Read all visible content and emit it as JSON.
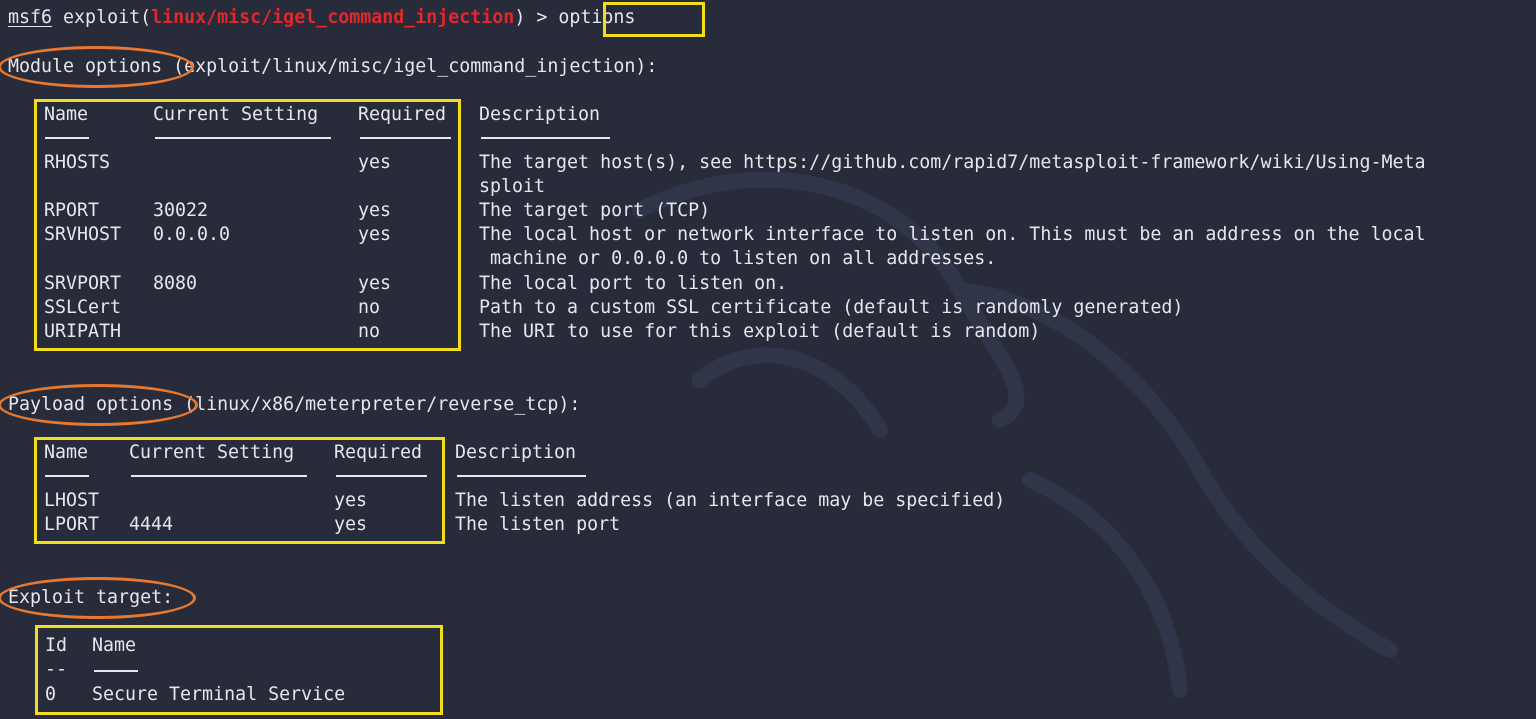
{
  "prompt": {
    "context": "msf6",
    "cmd_prefix": "exploit(",
    "module": "linux/misc/igel_command_injection",
    "cmd_suffix": ") >",
    "command": "options"
  },
  "module_options": {
    "header_label": "Module options",
    "header_rest": "(exploit/linux/misc/igel_command_injection):",
    "columns": [
      "Name",
      "Current Setting",
      "Required",
      "Description"
    ],
    "rows": [
      {
        "name": "RHOSTS",
        "setting": "",
        "required": "yes",
        "description": [
          "The target host(s), see https://github.com/rapid7/metasploit-framework/wiki/Using-Meta",
          "sploit"
        ]
      },
      {
        "name": "RPORT",
        "setting": "30022",
        "required": "yes",
        "description": [
          "The target port (TCP)"
        ]
      },
      {
        "name": "SRVHOST",
        "setting": "0.0.0.0",
        "required": "yes",
        "description": [
          "The local host or network interface to listen on. This must be an address on the local",
          " machine or 0.0.0.0 to listen on all addresses."
        ]
      },
      {
        "name": "SRVPORT",
        "setting": "8080",
        "required": "yes",
        "description": [
          "The local port to listen on."
        ]
      },
      {
        "name": "SSLCert",
        "setting": "",
        "required": "no",
        "description": [
          "Path to a custom SSL certificate (default is randomly generated)"
        ]
      },
      {
        "name": "URIPATH",
        "setting": "",
        "required": "no",
        "description": [
          "The URI to use for this exploit (default is random)"
        ]
      }
    ]
  },
  "payload_options": {
    "header_label": "Payload options",
    "header_rest": "(linux/x86/meterpreter/reverse_tcp):",
    "columns": [
      "Name",
      "Current Setting",
      "Required",
      "Description"
    ],
    "rows": [
      {
        "name": "LHOST",
        "setting": "",
        "required": "yes",
        "description": [
          "The listen address (an interface may be specified)"
        ]
      },
      {
        "name": "LPORT",
        "setting": "4444",
        "required": "yes",
        "description": [
          "The listen port"
        ]
      }
    ]
  },
  "exploit_target": {
    "header_label": "Exploit target:",
    "columns": [
      "Id",
      "Name"
    ],
    "separator": "--",
    "rows": [
      {
        "id": "0",
        "name": "Secure Terminal Service"
      }
    ]
  },
  "colors": {
    "background": "#272b3a",
    "text": "#e6e7ec",
    "module_red": "#e5262c",
    "highlight_box_yellow": "#f4dc1e",
    "highlight_oval_orange": "#e8782f"
  }
}
